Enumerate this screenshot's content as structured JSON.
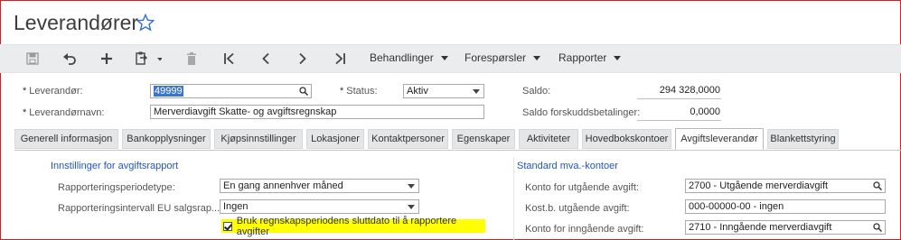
{
  "page": {
    "title": "Leverandører"
  },
  "toolbar": {
    "menus": [
      "Behandlinger",
      "Forespørsler",
      "Rapporter"
    ]
  },
  "header": {
    "vendor_label": "Leverandør:",
    "vendor_value": "49999",
    "status_label": "Status:",
    "status_value": "Aktiv",
    "balance_label": "Saldo:",
    "balance_value": "294 328,0000",
    "vendorname_label": "Leverandørnavn:",
    "vendorname_value": "Merverdiavgift Skatte- og avgiftsregnskap",
    "prepay_label": "Saldo forskuddsbetalinger:",
    "prepay_value": "0,0000"
  },
  "tabs": [
    "Generell informasjon",
    "Bankopplysninger",
    "Kjøpsinnstillinger",
    "Lokasjoner",
    "Kontaktpersoner",
    "Egenskaper",
    "Aktiviteter",
    "Hovedbokskontoer",
    "Avgiftsleverandør",
    "Blankettstyring"
  ],
  "active_tab": "Avgiftsleverandør",
  "left_section": {
    "heading": "Innstillinger for avgiftsrapport",
    "period_type_label": "Rapporteringsperiodetype:",
    "period_type_value": "En gang annenhver måned",
    "eu_interval_label": "Rapporteringsintervall EU salgsrap...",
    "eu_interval_value": "Ingen",
    "checkbox_label": "Bruk regnskapsperiodens sluttdato til å rapportere avgifter",
    "checkbox_checked": true
  },
  "right_section": {
    "heading": "Standard mva.-kontoer",
    "out_vat_label": "Konto for utgående avgift:",
    "out_vat_value": "2700 - Utgående merverdiavgift",
    "sub_label": "Kost.b. utgående avgift:",
    "sub_value": "000-00000-00 - ingen",
    "in_vat_label": "Konto for inngående avgift:",
    "in_vat_value": "2710 - Inngående merverdiavgift"
  },
  "colors": {
    "accent": "#1f54c9",
    "highlight": "#ffff00",
    "frame": "#d42020"
  },
  "icons": [
    "save-icon",
    "undo-icon",
    "add-icon",
    "copy-paste-icon",
    "delete-icon",
    "first-record-icon",
    "previous-record-icon",
    "next-record-icon",
    "last-record-icon",
    "search-icon",
    "star-icon"
  ]
}
